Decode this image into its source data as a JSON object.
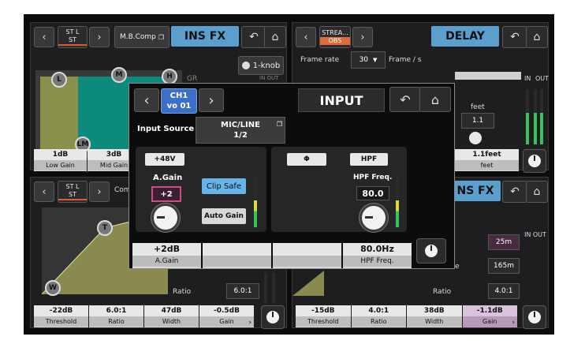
{
  "top_left": {
    "channel": {
      "line1": "ST L",
      "line2": "ST"
    },
    "module_label": "M.B.Comp",
    "title": "INS FX",
    "one_knob": "1-knob",
    "gr_label": "GR",
    "in_out_label": "IN  OUT",
    "nodes": [
      "L",
      "M",
      "H",
      "LM"
    ],
    "params": [
      {
        "value": "1dB",
        "label": "Low Gain"
      },
      {
        "value": "3dB",
        "label": "Mid Gain"
      }
    ]
  },
  "top_right": {
    "channel": {
      "line1": "STREA...",
      "line2": "OBS"
    },
    "title": "DELAY",
    "frame_rate_label": "Frame rate",
    "frame_rate_value": "30",
    "frame_unit": "Frame / s",
    "in_label": "IN",
    "out_label": "OUT",
    "feet_label": "feet",
    "feet_value": "1.1",
    "param": {
      "value": "1.1feet",
      "label": "feet"
    }
  },
  "bottom_left": {
    "channel": {
      "line1": "ST L",
      "line2": "ST"
    },
    "module_label": "Com",
    "nodes": [
      "T",
      "W"
    ],
    "ratio_label": "Ratio",
    "ratio_value": "6.0:1",
    "params": [
      {
        "value": "-22dB",
        "label": "Threshold"
      },
      {
        "value": "6.0:1",
        "label": "Ratio"
      },
      {
        "value": "47dB",
        "label": "Width"
      },
      {
        "value": "-0.5dB",
        "label": "Gain"
      }
    ]
  },
  "bottom_right": {
    "title_partial": "NS FX",
    "in_out_label": "IN  OUT",
    "value_25m": "25m",
    "value_165m": "165m",
    "ratio_label": "Ratio",
    "ratio_value": "4.0:1",
    "e_label": "e",
    "params": [
      {
        "value": "-15dB",
        "label": "Threshold"
      },
      {
        "value": "4.0:1",
        "label": "Ratio"
      },
      {
        "value": "38dB",
        "label": "Width"
      },
      {
        "value": "-1.1dB",
        "label": "Gain"
      }
    ]
  },
  "input_popup": {
    "channel": {
      "line1": "CH1",
      "line2": "vo 01"
    },
    "title": "INPUT",
    "input_source_label": "Input Source",
    "input_source_value": {
      "line1": "MIC/LINE",
      "line2": "1/2"
    },
    "phantom": "+48V",
    "again_label": "A.Gain",
    "again_value": "+2",
    "clip_safe": "Clip Safe",
    "auto_gain": "Auto Gain",
    "phase": "Φ",
    "hpf": "HPF",
    "hpf_freq_label": "HPF Freq.",
    "hpf_freq_value": "80.0",
    "strip": [
      {
        "value": "+2dB",
        "label": "A.Gain"
      },
      {
        "value": "",
        "label": ""
      },
      {
        "value": "",
        "label": ""
      },
      {
        "value": "80.0Hz",
        "label": "HPF Freq."
      }
    ]
  },
  "icons": [
    "back-arrow-icon",
    "home-icon",
    "knob-icon",
    "chevron-left-icon",
    "chevron-right-icon",
    "copy-icon",
    "dropdown-icon"
  ],
  "colors": {
    "accent_blue": "#5b9fcf",
    "meter_green": "#34c45a",
    "meter_yellow": "#d8d93a",
    "channel_underline": "#e05a32",
    "input_badge": "#3c70c8",
    "again_pink": "#d04a8a"
  }
}
